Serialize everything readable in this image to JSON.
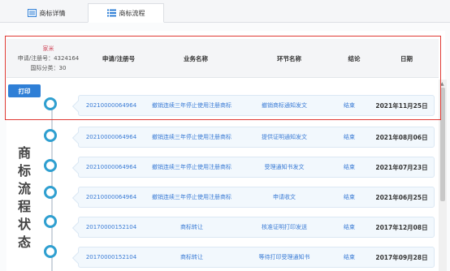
{
  "tabs": [
    {
      "label": "商标详情"
    },
    {
      "label": "商标流程"
    }
  ],
  "header": {
    "owner": "家米",
    "reg_no": "申请/注册号：4324164",
    "class": "国际分类：30",
    "columns": [
      "申请/注册号",
      "业务名称",
      "环节名称",
      "结论",
      "日期"
    ]
  },
  "print_label": "打印",
  "status_title": [
    "商",
    "标",
    "流",
    "程",
    "状",
    "态"
  ],
  "rows": [
    {
      "reg": "20210000064964",
      "business": "撤销连续三年停止使用注册商标",
      "step": "撤销商标通知发文",
      "result": "结束",
      "date": "2021年11月25日"
    },
    {
      "reg": "20210000064964",
      "business": "撤销连续三年停止使用注册商标",
      "step": "提供证明通知发文",
      "result": "结束",
      "date": "2021年08月06日"
    },
    {
      "reg": "20210000064964",
      "business": "撤销连续三年停止使用注册商标",
      "step": "受理通知书发文",
      "result": "结束",
      "date": "2021年07月23日"
    },
    {
      "reg": "20210000064964",
      "business": "撤销连续三年停止使用注册商标",
      "step": "申请收文",
      "result": "结束",
      "date": "2021年06月25日"
    },
    {
      "reg": "20170000152104",
      "business": "商标转让",
      "step": "核准证明打印发送",
      "result": "结束",
      "date": "2017年12月08日"
    },
    {
      "reg": "20170000152104",
      "business": "商标转让",
      "step": "等待打印受理通知书",
      "result": "结束",
      "date": "2017年09月28日"
    }
  ]
}
